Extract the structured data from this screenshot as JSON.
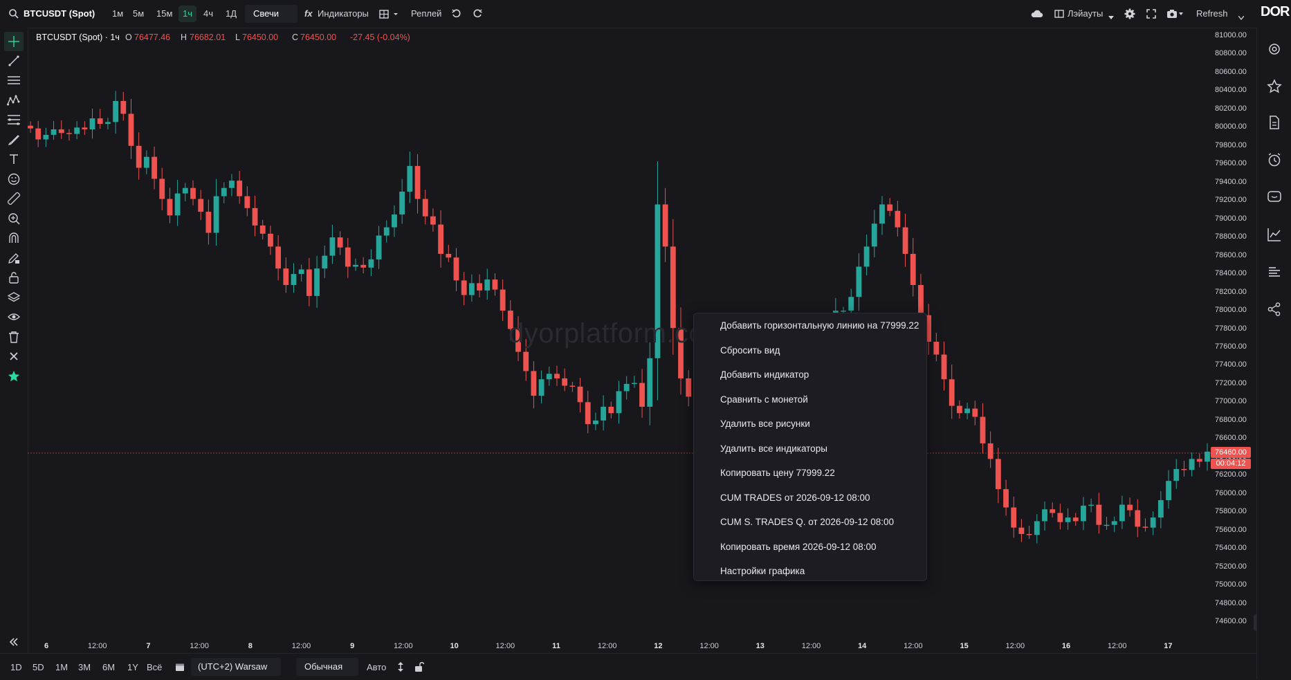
{
  "topbar": {
    "symbol": "BTCUSDT (Spot)",
    "timeframes": [
      "1м",
      "5м",
      "15м",
      "1ч",
      "4ч",
      "1Д"
    ],
    "active_timeframe": "1ч",
    "chart_type": "Свечи",
    "indicators_label": "Индикаторы",
    "replay_label": "Реплей",
    "layouts_label": "Лэйауты",
    "refresh_label": "Refresh",
    "logo_text": "DOR"
  },
  "legend": {
    "title": "BTCUSDT (Spot) · 1ч",
    "o_key": "O",
    "o_val": "76477.46",
    "h_key": "H",
    "h_val": "76682.01",
    "l_key": "L",
    "l_val": "76450.00",
    "c_key": "C",
    "c_val": "76450.00",
    "change": "-27.45 (-0.04%)"
  },
  "watermark": "dyorplatform.co",
  "price_axis": {
    "labels": [
      "81000.00",
      "80800.00",
      "80600.00",
      "80400.00",
      "80200.00",
      "80000.00",
      "79800.00",
      "79600.00",
      "79400.00",
      "79200.00",
      "79000.00",
      "78800.00",
      "78600.00",
      "78400.00",
      "78200.00",
      "78000.00",
      "77800.00",
      "77600.00",
      "77400.00",
      "77200.00",
      "77000.00",
      "76800.00",
      "76600.00",
      "76400.00",
      "76200.00",
      "76000.00",
      "75800.00",
      "75600.00",
      "75400.00",
      "75200.00",
      "75000.00",
      "74800.00",
      "74600.00"
    ],
    "last_price": "76460.00",
    "countdown": "00:04:12"
  },
  "time_axis": {
    "labels": [
      {
        "t": "6",
        "day": true
      },
      {
        "t": "12:00",
        "day": false
      },
      {
        "t": "7",
        "day": true
      },
      {
        "t": "12:00",
        "day": false
      },
      {
        "t": "8",
        "day": true
      },
      {
        "t": "12:00",
        "day": false
      },
      {
        "t": "9",
        "day": true
      },
      {
        "t": "12:00",
        "day": false
      },
      {
        "t": "10",
        "day": true
      },
      {
        "t": "12:00",
        "day": false
      },
      {
        "t": "11",
        "day": true
      },
      {
        "t": "12:00",
        "day": false
      },
      {
        "t": "12",
        "day": true
      },
      {
        "t": "12:00",
        "day": false
      },
      {
        "t": "13",
        "day": true
      },
      {
        "t": "12:00",
        "day": false
      },
      {
        "t": "14",
        "day": true
      },
      {
        "t": "12:00",
        "day": false
      },
      {
        "t": "15",
        "day": true
      },
      {
        "t": "12:00",
        "day": false
      },
      {
        "t": "16",
        "day": true
      },
      {
        "t": "12:00",
        "day": false
      },
      {
        "t": "17",
        "day": true
      }
    ]
  },
  "context_menu": {
    "items": [
      "Добавить горизонтальную линию на 77999.22",
      "Сбросить вид",
      "Добавить индикатор",
      "Сравнить с монетой",
      "Удалить все рисунки",
      "Удалить все индикаторы",
      "Копировать цену 77999.22",
      "CUM TRADES от 2026-09-12 08:00",
      "CUM S. TRADES Q. от 2026-09-12 08:00",
      "Копировать время 2026-09-12 08:00",
      "Настройки графика"
    ]
  },
  "bottombar": {
    "ranges": [
      "1D",
      "5D",
      "1M",
      "3M",
      "6M",
      "1Y",
      "Всё"
    ],
    "timezone": "(UTC+2) Warsaw",
    "scale_mode": "Обычная",
    "auto_label": "Авто"
  },
  "colors": {
    "up": "#26a69a",
    "down": "#ef5350",
    "accent": "#2bd9a1",
    "background": "#17171c"
  },
  "chart_data": {
    "type": "candlestick",
    "symbol": "BTCUSDT",
    "interval": "1h",
    "ylim": [
      74600,
      81000
    ],
    "x_range": [
      "6 00:00",
      "17 ~09:00"
    ],
    "last_price": 76460.0,
    "series_close": [
      79990,
      79870,
      79920,
      79980,
      79940,
      79930,
      80000,
      79980,
      80100,
      80040,
      80060,
      80290,
      80150,
      79800,
      79560,
      79680,
      79440,
      79220,
      79040,
      79280,
      79340,
      79220,
      79080,
      78850,
      79250,
      79340,
      79420,
      79250,
      79120,
      78930,
      78840,
      78700,
      78460,
      78280,
      78400,
      78450,
      78160,
      78460,
      78600,
      78800,
      78690,
      78480,
      78500,
      78470,
      78560,
      78820,
      78910,
      79050,
      79300,
      79580,
      79220,
      79030,
      78940,
      78620,
      78580,
      78330,
      78170,
      78300,
      78220,
      78340,
      78230,
      78000,
      77800,
      77550,
      77340,
      77070,
      77250,
      77310,
      77260,
      77180,
      77170,
      77000,
      76760,
      76800,
      76950,
      76880,
      77120,
      77200,
      77210,
      76950,
      77480,
      79160,
      78700,
      77810,
      77260,
      77060,
      77310,
      77150,
      77200,
      77240,
      77200,
      77180,
      77200,
      77100,
      77070,
      77030,
      77020,
      77170,
      77180,
      77200,
      77300,
      77400,
      77600,
      77800,
      78000,
      78000,
      78150,
      78480,
      78700,
      78950,
      79160,
      79090,
      78910,
      78620,
      78280,
      77950,
      77660,
      77520,
      77250,
      76960,
      76880,
      76930,
      76840,
      76550,
      76380,
      76050,
      75850,
      75630,
      75560,
      75550,
      75700,
      75830,
      75790,
      75690,
      75740,
      75700,
      75870,
      75880,
      75660,
      75660,
      75700,
      75880,
      75820,
      75640,
      75630,
      75740,
      75930,
      76140,
      76270,
      76260,
      76380,
      76350,
      76460
    ]
  }
}
